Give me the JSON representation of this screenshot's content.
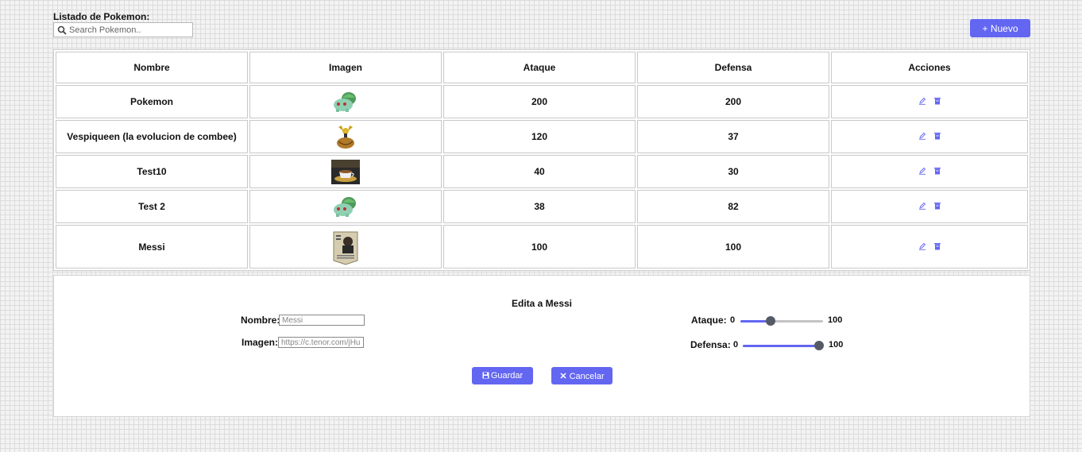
{
  "header": {
    "title": "Listado de Pokemon:",
    "search_placeholder": "Search Pokemon..",
    "new_button": "+ Nuevo"
  },
  "table": {
    "columns": [
      "Nombre",
      "Imagen",
      "Ataque",
      "Defensa",
      "Acciones"
    ],
    "rows": [
      {
        "nombre": "Pokemon",
        "imagen": "bulbasaur",
        "ataque": "200",
        "defensa": "200"
      },
      {
        "nombre": "Vespiqueen (la evolucion de combee)",
        "imagen": "vespiqueen",
        "ataque": "120",
        "defensa": "37"
      },
      {
        "nombre": "Test10",
        "imagen": "coffee-cup",
        "ataque": "40",
        "defensa": "30"
      },
      {
        "nombre": "Test 2",
        "imagen": "bulbasaur",
        "ataque": "38",
        "defensa": "82"
      },
      {
        "nombre": "Messi",
        "imagen": "messi-card",
        "ataque": "100",
        "defensa": "100"
      }
    ],
    "action_icons": [
      "edit-icon",
      "delete-icon"
    ]
  },
  "edit_form": {
    "title": "Edita a Messi",
    "nombre_label": "Nombre:",
    "nombre_placeholder": "Messi",
    "imagen_label": "Imagen:",
    "imagen_placeholder": "https://c.tenor.com/jHu",
    "ataque_label": "Ataque:",
    "ataque_min": "0",
    "ataque_max": "100",
    "ataque_value": 0.37,
    "defensa_label": "Defensa:",
    "defensa_min": "0",
    "defensa_max": "100",
    "defensa_value": 1.0,
    "save_button": "Guardar",
    "cancel_button": "Cancelar"
  },
  "colors": {
    "accent": "#6366f1",
    "thumb": "#555a66"
  }
}
